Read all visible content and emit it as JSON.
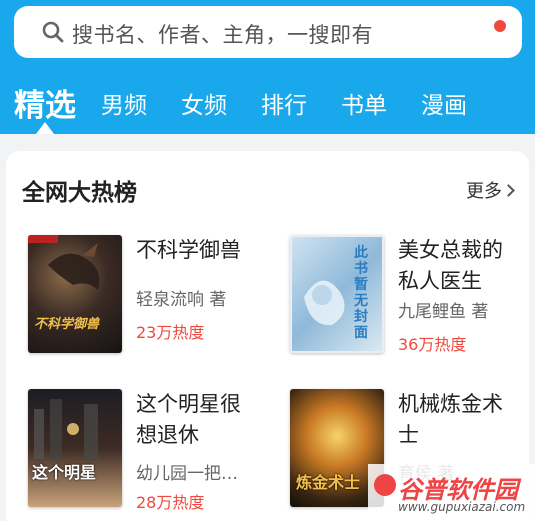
{
  "search": {
    "placeholder": "搜书名、作者、主角，一搜即有"
  },
  "tabs": [
    {
      "label": "精选",
      "active": true
    },
    {
      "label": "男频"
    },
    {
      "label": "女频"
    },
    {
      "label": "排行"
    },
    {
      "label": "书单"
    },
    {
      "label": "漫画"
    }
  ],
  "section": {
    "title": "全网大热榜",
    "more_label": "更多"
  },
  "books": [
    {
      "title": "不科学御兽",
      "author": "轻泉流响 著",
      "heat": "23万热度",
      "cover_text": "不科学御兽"
    },
    {
      "title": "美女总裁的私人医生",
      "author": "九尾鲤鱼 著",
      "heat": "36万热度",
      "cover_text": "此书暂无封面"
    },
    {
      "title": "这个明星很想退休",
      "author": "幼儿园一把…",
      "heat": "28万热度",
      "cover_text": "这个明星"
    },
    {
      "title": "机械炼金术士",
      "author": "育侯 著",
      "heat": "",
      "cover_text": "炼金术士"
    }
  ],
  "watermark": {
    "text": "谷普软件园",
    "url": "www.gupuxiazai.com"
  },
  "colors": {
    "accent": "#1aa8ec",
    "heat": "#f04a3e",
    "badge": "#f04a3e"
  }
}
